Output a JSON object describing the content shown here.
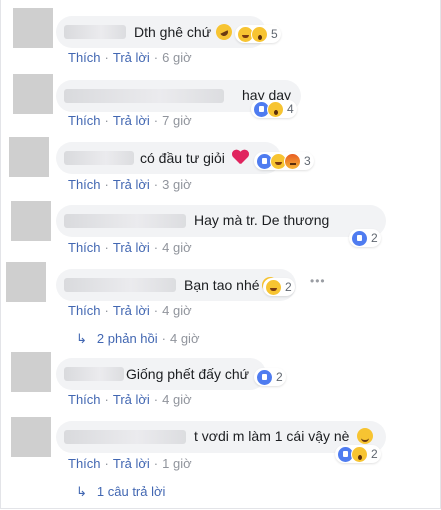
{
  "actions": {
    "like": "Thích",
    "reply": "Trả lời"
  },
  "comments": [
    {
      "text": "Dth ghê chứ",
      "count": "5",
      "time": "6 giờ",
      "icon": "rolling-laughing-emoji",
      "reactions": [
        "haha",
        "wow"
      ]
    },
    {
      "text": "hay day",
      "count": "4",
      "time": "7 giờ",
      "reactions": [
        "like",
        "wow"
      ]
    },
    {
      "text": "có đầu tư giỏi",
      "count": "3",
      "time": "3 giờ",
      "icon": "heart-emoji",
      "reactions": [
        "like",
        "haha",
        "angry"
      ]
    },
    {
      "text": "Hay mà tr. De thương",
      "count": "2",
      "time": "4 giờ",
      "reactions": [
        "like"
      ]
    },
    {
      "text": "Bạn tao nhé",
      "count": "2",
      "time": "4 giờ",
      "reactions": [
        "haha"
      ],
      "replies": "2 phản hồi",
      "replies_time": "4 giờ"
    },
    {
      "text": "Giống phết đấy chứ",
      "count": "2",
      "time": "4 giờ",
      "reactions": [
        "like"
      ]
    },
    {
      "text": "t vơdi m làm 1 cái vậy nè",
      "count": "2",
      "time": "1 giờ",
      "icon": "slightly-smiling-emoji",
      "reactions": [
        "like",
        "wow"
      ],
      "replies": "1 câu trả lời"
    }
  ],
  "more_icon": "ellipsis-icon",
  "reply_arrow_icon": "reply-arrow-icon",
  "colors": {
    "link": "#4267b2",
    "bubble": "#f2f3f5",
    "meta": "#90949c"
  }
}
